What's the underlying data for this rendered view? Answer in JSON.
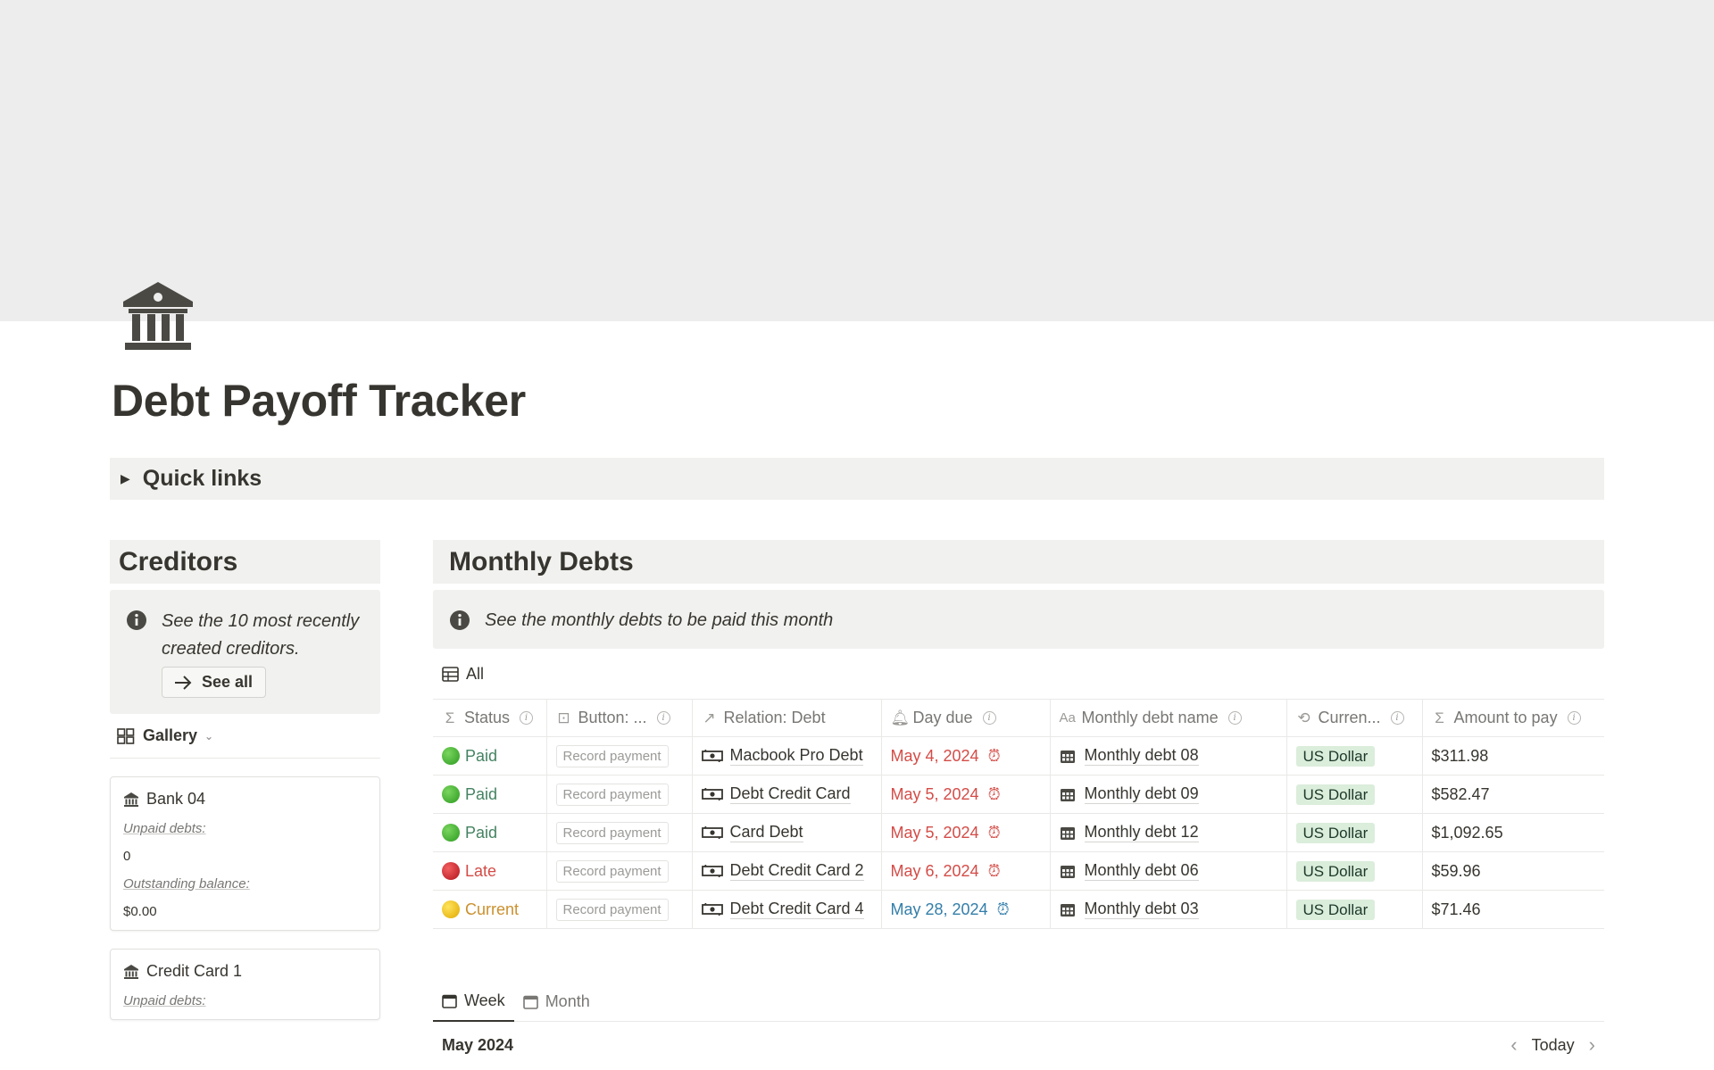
{
  "page": {
    "title": "Debt Payoff Tracker",
    "icon": "bank-icon",
    "quick_links_label": "Quick links"
  },
  "creditors": {
    "heading": "Creditors",
    "callout_text": "See the 10 most recently created creditors.",
    "see_all_label": "See all",
    "view_label": "Gallery",
    "cards": [
      {
        "title": "Bank 04",
        "props": [
          {
            "label": "Unpaid debts:",
            "value": "0"
          },
          {
            "label": "Outstanding balance:",
            "value": "$0.00"
          }
        ]
      },
      {
        "title": "Credit Card 1",
        "props": [
          {
            "label": "Unpaid debts:",
            "value": ""
          }
        ]
      }
    ]
  },
  "monthly_debts": {
    "heading": "Monthly Debts",
    "callout_text": "See the monthly debts to be paid this month",
    "view_label": "All",
    "columns": [
      "Status",
      "Button: ...",
      "Relation: Debt",
      "Day due",
      "Monthly debt name",
      "Curren...",
      "Amount to pay"
    ],
    "rows": [
      {
        "status": "Paid",
        "button": "Record payment",
        "debt": "Macbook Pro Debt",
        "due": "May 4, 2024",
        "name": "Monthly debt 08",
        "currency": "US Dollar",
        "amount": "$311.98"
      },
      {
        "status": "Paid",
        "button": "Record payment",
        "debt": "Debt Credit Card",
        "due": "May 5, 2024",
        "name": "Monthly debt 09",
        "currency": "US Dollar",
        "amount": "$582.47"
      },
      {
        "status": "Paid",
        "button": "Record payment",
        "debt": "Card Debt",
        "due": "May 5, 2024",
        "name": "Monthly debt 12",
        "currency": "US Dollar",
        "amount": "$1,092.65"
      },
      {
        "status": "Late",
        "button": "Record payment",
        "debt": "Debt Credit Card 2",
        "due": "May 6, 2024",
        "name": "Monthly debt 06",
        "currency": "US Dollar",
        "amount": "$59.96"
      },
      {
        "status": "Current",
        "button": "Record payment",
        "debt": "Debt Credit Card 4",
        "due": "May 28, 2024",
        "name": "Monthly debt 03",
        "currency": "US Dollar",
        "amount": "$71.46"
      }
    ]
  },
  "calendar": {
    "tabs": [
      "Week",
      "Month"
    ],
    "month_label": "May 2024",
    "today_label": "Today"
  },
  "colors": {
    "paid": "#448361",
    "late": "#d44c47",
    "current": "#cb912f",
    "due_overdue": "#d44c47",
    "due_upcoming": "#337ea9",
    "currency_pill_bg": "#dbeddb"
  }
}
